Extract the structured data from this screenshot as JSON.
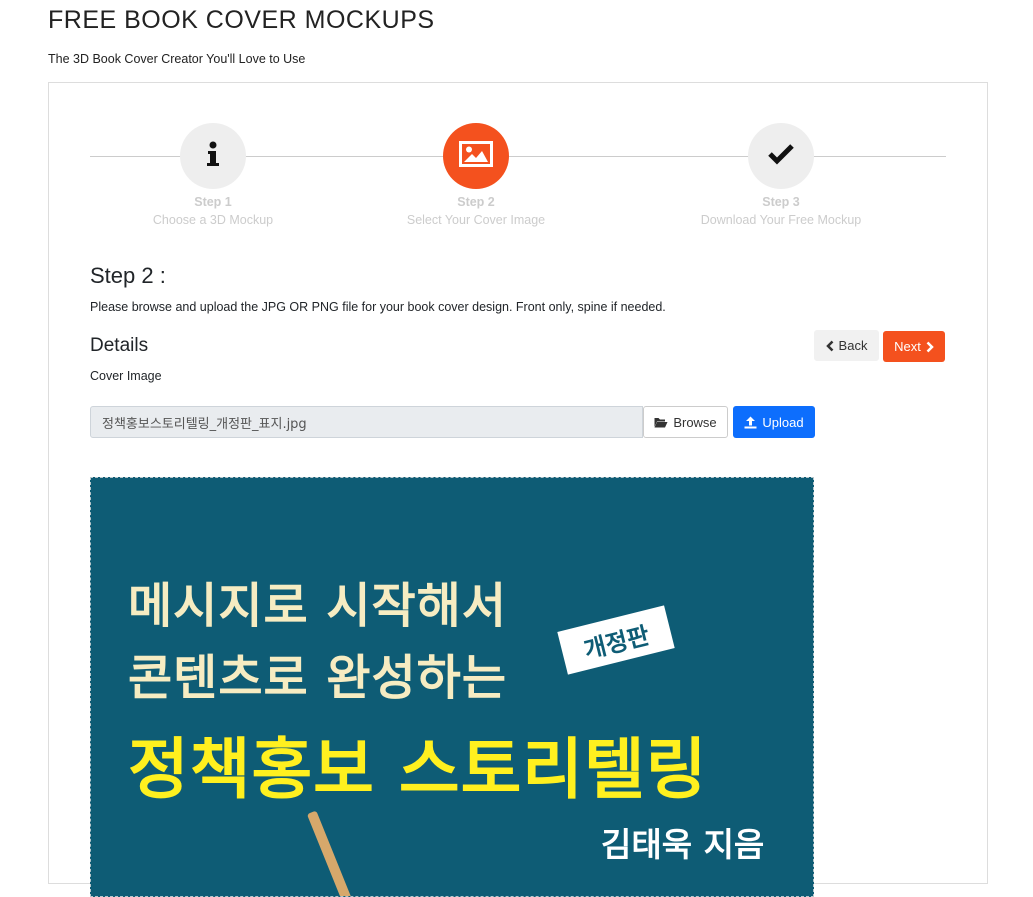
{
  "header": {
    "title": "FREE BOOK COVER MOCKUPS",
    "subtitle": "The 3D Book Cover Creator You'll Love to Use"
  },
  "steps": [
    {
      "num": "Step 1",
      "desc": "Choose a 3D Mockup",
      "icon": "info-icon",
      "active": false
    },
    {
      "num": "Step 2",
      "desc": "Select Your Cover Image",
      "icon": "image-icon",
      "active": true
    },
    {
      "num": "Step 3",
      "desc": "Download Your Free Mockup",
      "icon": "check-icon",
      "active": false
    }
  ],
  "main": {
    "heading": "Step 2 :",
    "instructions": "Please browse and upload the JPG OR PNG file for your book cover design. Front only, spine if needed.",
    "details_heading": "Details",
    "cover_label": "Cover Image",
    "file_value": "정책홍보스토리텔링_개정판_표지.jpg",
    "back_label": "Back",
    "next_label": "Next",
    "browse_label": "Browse",
    "upload_label": "Upload"
  },
  "cover": {
    "line1": "메시지로 시작해서",
    "line2": "콘텐츠로 완성하는",
    "badge": "개정판",
    "title": "정책홍보 스토리텔링",
    "author": "김태욱 지음"
  },
  "colors": {
    "accent": "#f4511e",
    "primary": "#0d6efd",
    "cover_bg": "#0e5c75",
    "cover_title": "#fff01f",
    "cover_text": "#f6ecc2"
  }
}
